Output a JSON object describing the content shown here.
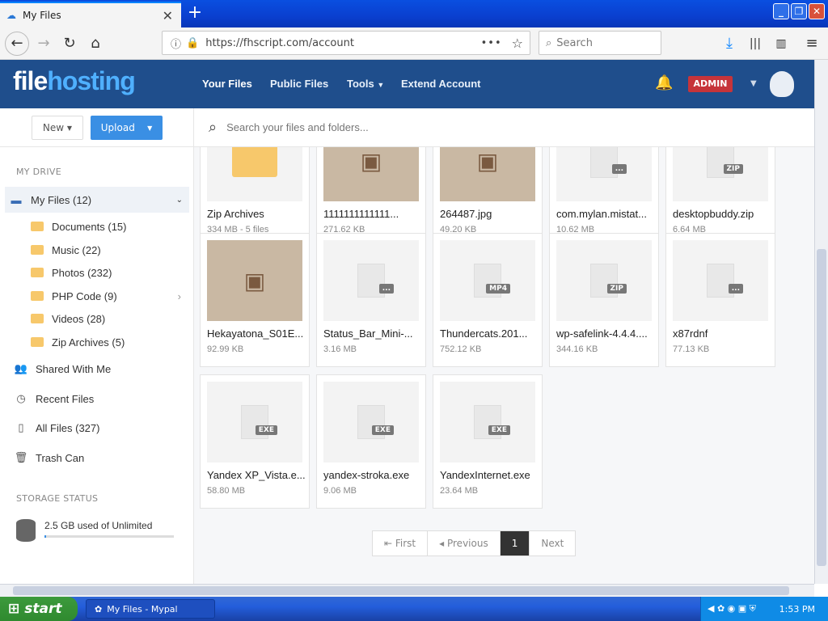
{
  "browser": {
    "tab_title": "My Files",
    "url": "https://fhscript.com/account",
    "search_placeholder": "Search"
  },
  "header": {
    "logo_part1": "file",
    "logo_part2": "hosting",
    "nav": [
      "Your Files",
      "Public Files",
      "Tools",
      "Extend Account"
    ],
    "admin_badge": "ADMIN"
  },
  "toolbar": {
    "new_label": "New",
    "upload_label": "Upload"
  },
  "search": {
    "placeholder": "Search your files and folders..."
  },
  "sidebar": {
    "my_drive_heading": "MY DRIVE",
    "my_files": "My Files (12)",
    "folders": [
      "Documents (15)",
      "Music (22)",
      "Photos (232)",
      "PHP Code (9)",
      "Videos (28)",
      "Zip Archives (5)"
    ],
    "links": [
      "Shared With Me",
      "Recent Files",
      "All Files (327)",
      "Trash Can"
    ],
    "storage_heading": "STORAGE STATUS",
    "storage_text": "2.5 GB used of Unlimited",
    "storage_fraction": 0.01
  },
  "files": [
    {
      "name": "Zip Archives",
      "size": "334 MB - 5 files",
      "kind": "folder"
    },
    {
      "name": "1111111111111...",
      "size": "271.62 KB",
      "kind": "photo"
    },
    {
      "name": "264487.jpg",
      "size": "49.20 KB",
      "kind": "photo"
    },
    {
      "name": "com.mylan.mistat...",
      "size": "10.62 MB",
      "kind": "generic"
    },
    {
      "name": "desktopbuddy.zip",
      "size": "6.64 MB",
      "kind": "zip"
    },
    {
      "name": "Hekayatona_S01E...",
      "size": "92.99 KB",
      "kind": "photo"
    },
    {
      "name": "Status_Bar_Mini-...",
      "size": "3.16 MB",
      "kind": "generic"
    },
    {
      "name": "Thundercats.201...",
      "size": "752.12 KB",
      "kind": "MP4"
    },
    {
      "name": "wp-safelink-4.4.4....",
      "size": "344.16 KB",
      "kind": "ZIP"
    },
    {
      "name": "x87rdnf",
      "size": "77.13 KB",
      "kind": "generic"
    },
    {
      "name": "Yandex XP_Vista.e...",
      "size": "58.80 MB",
      "kind": "EXE"
    },
    {
      "name": "yandex-stroka.exe",
      "size": "9.06 MB",
      "kind": "EXE"
    },
    {
      "name": "YandexInternet.exe",
      "size": "23.64 MB",
      "kind": "EXE"
    }
  ],
  "pager": {
    "first": "First",
    "previous": "Previous",
    "current": "1",
    "next": "Next"
  },
  "taskbar": {
    "start": "start",
    "task": "My Files - Mypal",
    "clock": "1:53 PM"
  }
}
